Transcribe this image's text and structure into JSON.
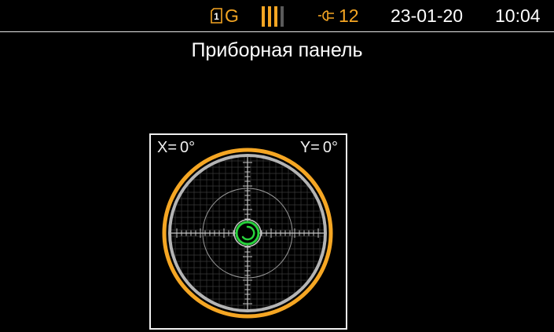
{
  "status_bar": {
    "sim_slot": "1",
    "sim_network": "G",
    "signal_level": 0.75,
    "battery_value": "12",
    "date": "23-01-20",
    "time": "10:04",
    "colors": {
      "accent": "#f5a623",
      "text": "#ffffff",
      "inactive": "#5a5a5a"
    },
    "icons": [
      "sim-card-icon",
      "signal-bars-icon",
      "battery-icon"
    ]
  },
  "page": {
    "title": "Приборная панель"
  },
  "level_gauge": {
    "x_label": "X=",
    "x_value": "0°",
    "y_label": "Y=",
    "y_value": "0°",
    "x_angle_deg": 0,
    "y_angle_deg": 0,
    "colors": {
      "outer_ring": "#f5a623",
      "inner_ring": "#b4b4b4",
      "grid": "#3a3a3a",
      "bubble": "#28d23c"
    }
  }
}
